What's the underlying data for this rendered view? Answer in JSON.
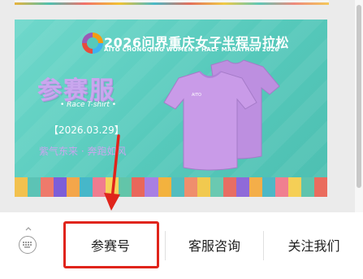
{
  "banner": {
    "event_title": "2026问界重庆女子半程马拉松",
    "event_subtitle": "AITO CHONGQING WOMEN'S HALF MARATHON 2026",
    "main_title": "参赛服",
    "tagline": "• Race T-shirt •",
    "date": "【2026.03.29】",
    "slogan": "紫气东来 · 奔跑如风",
    "shirt_brand": "AITO",
    "shirt_color": "#c99be8"
  },
  "bottom_menu": {
    "items": [
      {
        "label": "参赛号"
      },
      {
        "label": "客服咨询"
      },
      {
        "label": "关注我们"
      }
    ]
  },
  "annotation": {
    "color": "#e0241b"
  }
}
